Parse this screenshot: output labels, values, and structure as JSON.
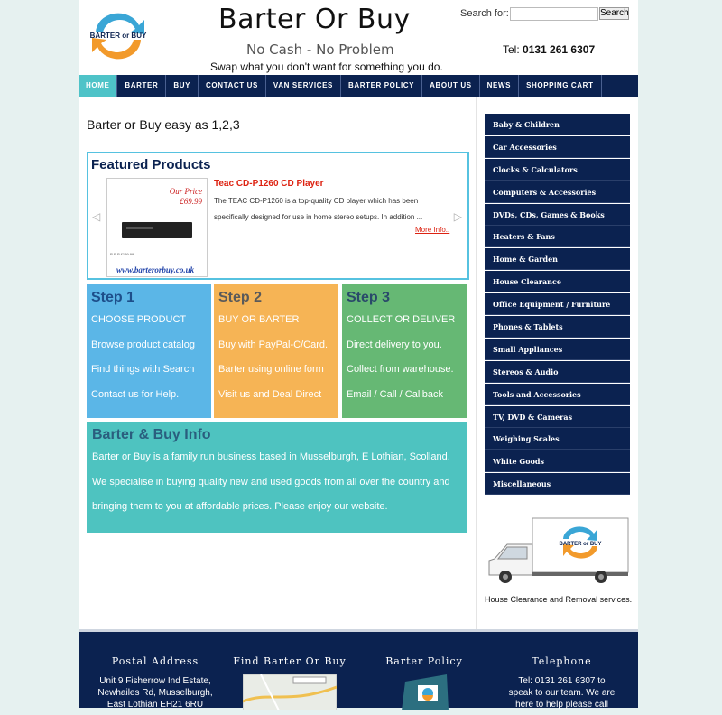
{
  "header": {
    "logo_text": "BARTER or BUY",
    "title": "Barter Or Buy",
    "tagline": "No Cash - No Problem",
    "subtagline": "Swap what you don't want for something you do.",
    "search_label": "Search for:",
    "search_value": "",
    "search_button": "Search",
    "phone_prefix": "Tel:",
    "phone_number": "0131 261 6307"
  },
  "nav": [
    {
      "label": "HOME"
    },
    {
      "label": "BARTER"
    },
    {
      "label": "BUY"
    },
    {
      "label": "CONTACT US"
    },
    {
      "label": "VAN SERVICES"
    },
    {
      "label": "BARTER POLICY"
    },
    {
      "label": "ABOUT US"
    },
    {
      "label": "NEWS"
    },
    {
      "label": "SHOPPING CART"
    }
  ],
  "main": {
    "intro": "Barter or Buy easy as 1,2,3",
    "featured": {
      "heading": "Featured Products",
      "product_name": "Teac CD-P1260 CD Player",
      "description": "The TEAC CD-P1260 is a top-quality CD player which has been specifically designed for use in home stereo setups. In addition ...",
      "more_info": "More Info..",
      "our_price_label": "Our Price",
      "price": "£69.99",
      "image_url_text": "www.barterorbuy.co.uk",
      "image_small_text": "R.R.P £199.99"
    },
    "steps": [
      {
        "title": "Step 1",
        "lines": [
          "CHOOSE PRODUCT",
          "Browse product catalog",
          "Find things with Search",
          "Contact us for Help."
        ]
      },
      {
        "title": "Step 2",
        "lines": [
          "BUY OR BARTER",
          "Buy with PayPal-C/Card.",
          "Barter using online form",
          "Visit us and Deal Direct"
        ]
      },
      {
        "title": "Step 3",
        "lines": [
          "COLLECT OR DELIVER",
          "Direct delivery to you.",
          "Collect from warehouse.",
          "Email / Call / Callback"
        ]
      }
    ],
    "info": {
      "title": "Barter & Buy Info",
      "lines": [
        "Barter or Buy is a family run business based in Musselburgh, E Lothian, Scolland.",
        "We specialise in buying quality new and used goods from all over the country and",
        "bringing them to you at affordable prices. Please enjoy our website."
      ]
    }
  },
  "sidebar": {
    "categories": [
      "Baby & Children",
      "Car Accessories",
      "Clocks & Calculators",
      "Computers & Accessories",
      "DVDs, CDs, Games & Books",
      "Heaters & Fans",
      "Home & Garden",
      "House Clearance",
      "Office Equipment / Furniture",
      "Phones & Tablets",
      "Small Appliances",
      "Stereos & Audio",
      "Tools and Accessories",
      "TV, DVD & Cameras",
      "Weighing Scales",
      "White Goods",
      "Miscellaneous"
    ],
    "truck_logo_text": "BARTER or BUY",
    "truck_caption": "House Clearance and Removal services."
  },
  "footer": {
    "postal_title": "Postal Address",
    "postal_lines": [
      "Unit 9 Fisherrow Ind Estate,",
      "Newhailes Rd, Musselburgh,",
      "East Lothian EH21 6RU"
    ],
    "find_title": "Find Barter Or Buy",
    "policy_title": "Barter Policy",
    "phone_title": "Telephone",
    "phone_lines": [
      "Tel: 0131 261 6307 to",
      "speak to our team. We are",
      "here to help please call"
    ]
  },
  "colors": {
    "navy": "#0b2250",
    "teal": "#4ec3c8",
    "step1": "#5bb6e7",
    "step2": "#f6b455",
    "step3": "#66b874",
    "info": "#4ec3c0",
    "price_red": "#d21"
  }
}
